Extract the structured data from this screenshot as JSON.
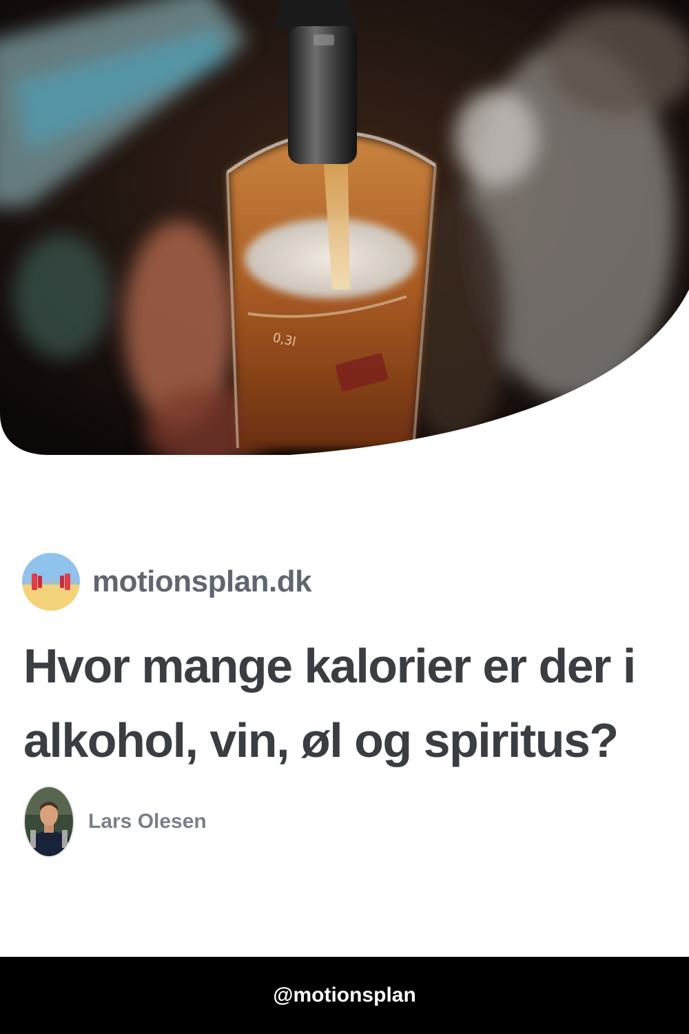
{
  "hero": {
    "image_label": "beer-pouring-photo",
    "glass_marking": "0,3l"
  },
  "site": {
    "logo_icon": "dumbbell-icon",
    "name": "motionsplan.dk"
  },
  "article": {
    "title": "Hvor mange kalorier er der i alkohol, vin, øl og spiritus?"
  },
  "author": {
    "name": "Lars Olesen"
  },
  "footer": {
    "handle": "@motionsplan"
  },
  "colors": {
    "site_name": "#5f6670",
    "title": "#3a3d42",
    "author_name": "#7a8088",
    "footer_bg": "#000000",
    "footer_text": "#ffffff"
  }
}
